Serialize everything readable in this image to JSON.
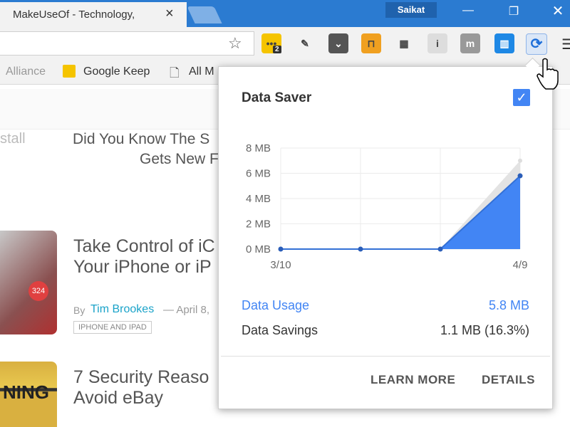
{
  "browser": {
    "tab_title": "MakeUseOf - Technology,",
    "tab_close": "×",
    "profile_name": "Saikat",
    "star": "☆"
  },
  "extensions": [
    {
      "name": "notes-extension",
      "badge": "2",
      "color": "#f5c400",
      "glyph": "•••"
    },
    {
      "name": "pin-extension",
      "color": "transparent",
      "glyph": "✎"
    },
    {
      "name": "pocket-extension",
      "color": "#555555",
      "glyph": "⌄"
    },
    {
      "name": "grid-extension",
      "color": "#f0a020",
      "glyph": "⊓"
    },
    {
      "name": "dashed-extension",
      "color": "transparent",
      "glyph": "▦"
    },
    {
      "name": "info-extension",
      "color": "#dddddd",
      "glyph": "i"
    },
    {
      "name": "m-extension",
      "color": "#999999",
      "glyph": "m"
    },
    {
      "name": "trello-extension",
      "color": "#1e88e5",
      "glyph": "▥"
    },
    {
      "name": "data-saver-extension",
      "color": "#dbe7f7",
      "glyph": "⟳"
    }
  ],
  "bookmarks": [
    "Alliance",
    "Google Keep",
    "All M"
  ],
  "page": {
    "side_text": "stall",
    "article1_title_line1": "Did You Know The S",
    "article1_title_line2": "Gets New F",
    "article2_title_line1": "Take Control of iC",
    "article2_title_line2": "Your iPhone or iP",
    "article2_by": "By",
    "article2_author": "Tim Brookes",
    "article2_date": "— April 8,",
    "article2_tag": "IPHONE AND IPAD",
    "article3_title_line1": "7 Security Reaso",
    "article3_title_line2": "Avoid eBay",
    "img_badge": "324",
    "img_label": "NING"
  },
  "popup": {
    "title": "Data Saver",
    "enabled": true,
    "data_usage_label": "Data Usage",
    "data_usage_value": "5.8 MB",
    "data_savings_label": "Data Savings",
    "data_savings_value": "1.1 MB (16.3%)",
    "learn_more": "LEARN MORE",
    "details": "DETAILS"
  },
  "chart_data": {
    "type": "area",
    "x_ticks": [
      "3/10",
      "4/9"
    ],
    "y_ticks": [
      "0 MB",
      "2 MB",
      "4 MB",
      "6 MB",
      "8 MB"
    ],
    "ylim": [
      0,
      8
    ],
    "points": [
      0,
      0,
      0,
      5.8
    ],
    "original_top": 7.0,
    "series_color": "#4285f4"
  }
}
